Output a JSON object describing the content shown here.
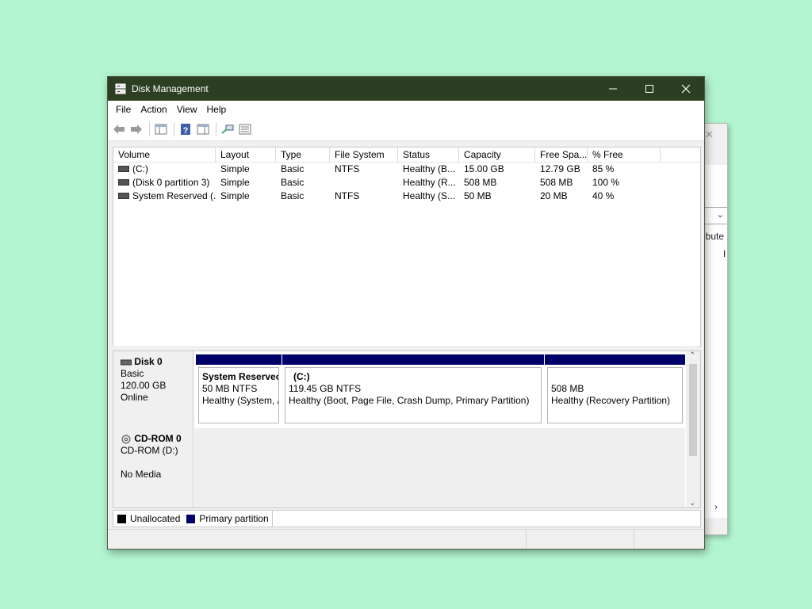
{
  "window": {
    "title": "Disk Management",
    "controls": [
      "minimize",
      "maximize",
      "close"
    ]
  },
  "menu": [
    "File",
    "Action",
    "View",
    "Help"
  ],
  "toolbar_icons": [
    "back-arrow-icon",
    "forward-arrow-icon",
    "show-hide-console-tree-icon",
    "help-icon",
    "properties-icon",
    "connect-icon",
    "list-view-icon"
  ],
  "volume_list": {
    "columns": [
      "Volume",
      "Layout",
      "Type",
      "File System",
      "Status",
      "Capacity",
      "Free Spa...",
      "% Free"
    ],
    "rows": [
      [
        "(C:)",
        "Simple",
        "Basic",
        "NTFS",
        "Healthy (B...",
        "15.00 GB",
        "12.79 GB",
        "85 %"
      ],
      [
        "(Disk 0 partition 3)",
        "Simple",
        "Basic",
        "",
        "Healthy (R...",
        "508 MB",
        "508 MB",
        "100 %"
      ],
      [
        "System Reserved (...",
        "Simple",
        "Basic",
        "NTFS",
        "Healthy (S...",
        "50 MB",
        "20 MB",
        "40 %"
      ]
    ]
  },
  "disks": [
    {
      "name": "Disk 0",
      "type": "Basic",
      "size": "120.00 GB",
      "state": "Online",
      "partitions": [
        {
          "name": "System Reservec",
          "size": "50 MB NTFS",
          "status": "Healthy (System, /"
        },
        {
          "name": "(C:)",
          "size": "119.45 GB NTFS",
          "status": "Healthy (Boot, Page File, Crash Dump, Primary Partition)"
        },
        {
          "name": "",
          "size": "508 MB",
          "status": "Healthy (Recovery Partition)"
        }
      ]
    },
    {
      "name": "CD-ROM 0",
      "type": "CD-ROM (D:)",
      "state": "No Media"
    }
  ],
  "legend": [
    {
      "label": "Unallocated",
      "color": "#000000"
    },
    {
      "label": "Primary partition",
      "color": "#00006b"
    }
  ],
  "background_window": {
    "text": "ibute",
    "text2": "I"
  }
}
